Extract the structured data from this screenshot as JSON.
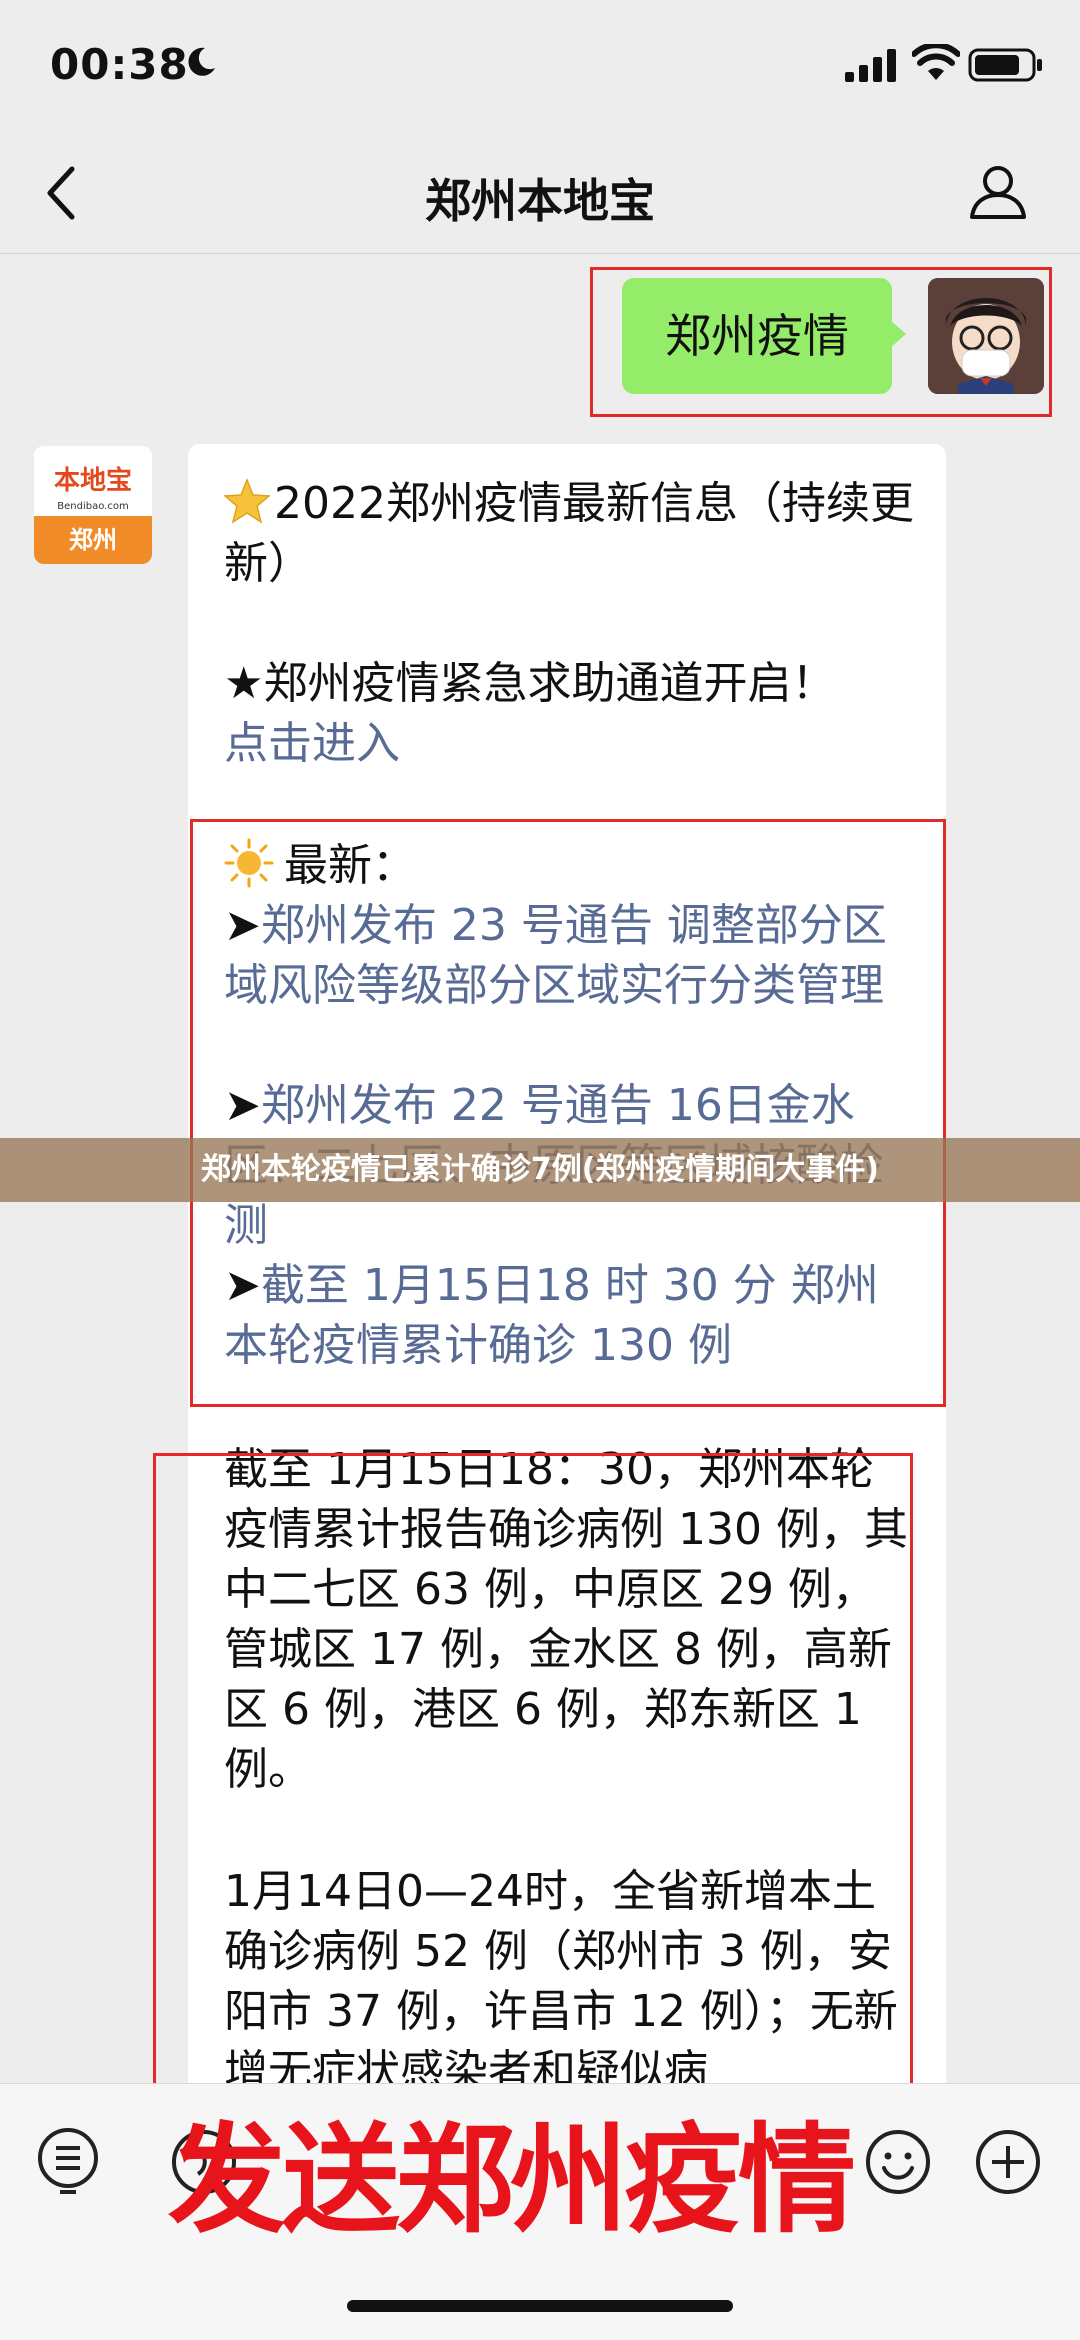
{
  "status_bar": {
    "time": "00:38"
  },
  "nav": {
    "title": "郑州本地宝"
  },
  "sent_message": {
    "text": "郑州疫情"
  },
  "bot": {
    "logo_text": "本地宝",
    "logo_domain": "Bendibao.com",
    "logo_city": "郑州"
  },
  "received_message": {
    "title": "2022郑州疫情最新信息（持续更新）",
    "urgent": "★郑州疫情紧急求助通道开启！",
    "urgent_link": "点击进入",
    "latest_label": "最新：",
    "arrow": "➤",
    "items": [
      "郑州发布 23 号通告 调整部分区域风险等级部分区域实行分类管理",
      "郑州发布 22 号通告 16日金水区、二七区、中原区等区域核酸检测",
      "截至 1月15日18 时 30 分 郑州本轮疫情累计确诊 130 例"
    ],
    "para1": "截至 1月15日18：30，郑州本轮疫情累计报告确诊病例 130 例，其中二七区 63 例，中原区 29 例，管城区 17 例，金水区 8 例，高新区 6 例，港区 6 例，郑东新区 1 例。",
    "para2": "1月14日0—24时，全省新增本土确诊病例 52 例（郑州市 3 例，安阳市 37 例，许昌市 12 例）；无新增无症状感染者和疑似病"
  },
  "caption": "郑州本轮疫情已累计确诊7例(郑州疫情期间大事件)",
  "overlay": {
    "text": "发送郑州疫情"
  },
  "colors": {
    "sent_bubble": "#95ec69",
    "link": "#576b95",
    "highlight": "#e12a2a",
    "overlay_text": "#e8141b",
    "logo_orange": "#f18b28"
  }
}
